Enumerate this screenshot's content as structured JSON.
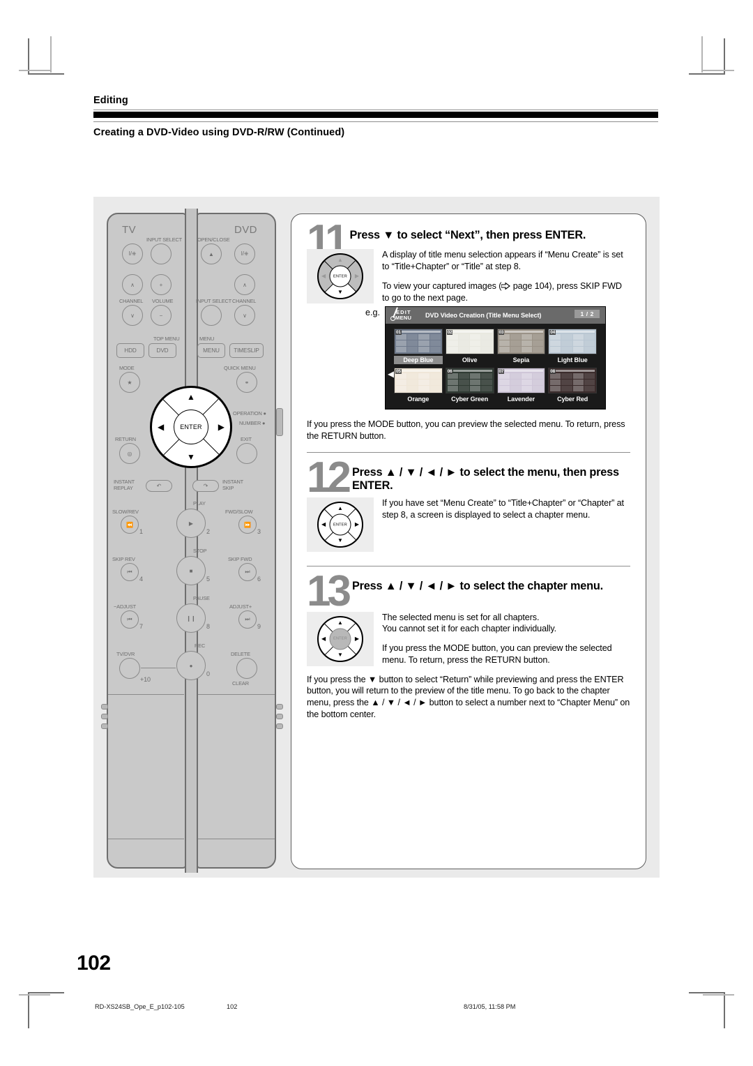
{
  "header": {
    "eyebrow": "Editing",
    "title": "Creating a DVD-Video using DVD-R/RW (Continued)"
  },
  "steps": [
    {
      "number": "11",
      "title": "Press ▼ to select “Next”, then press ENTER.",
      "dpad_label": "ENTER",
      "paragraphs": [
        "A display of title menu selection appears if “Menu Create” is set to “Title+Chapter” or “Title” at step 8.",
        "To view your captured images ( page 104), press SKIP FWD to go to the next page."
      ],
      "example_label": "e.g.",
      "after_note": "If you press the MODE button, you can preview the selected menu. To return, press the RETURN button."
    },
    {
      "number": "12",
      "title": "Press ▲ / ▼ / ◄ / ► to select the menu, then press ENTER.",
      "dpad_label": "ENTER",
      "paragraphs": [
        "If you have set “Menu Create” to “Title+Chapter” or “Chapter” at step 8, a screen is displayed to select a chapter menu."
      ]
    },
    {
      "number": "13",
      "title": "Press ▲ / ▼ / ◄ / ► to select the chapter menu.",
      "dpad_label": "ENTER",
      "paragraphs": [
        "The selected menu is set for all chapters.\nYou cannot set it for each chapter individually.",
        "If you press the MODE button, you can preview the selected menu. To return, press the RETURN button.",
        "If you press the ▼ button to select “Return” while previewing and press the ENTER button, you will return to the preview of the title menu. To go back to the chapter menu, press the ▲ / ▼ / ◄ / ► button to select a number next to “Chapter Menu” on the bottom center."
      ]
    }
  ],
  "screenshot": {
    "logo_line1": "EDIT",
    "logo_line2": "MENU",
    "title": "DVD Video Creation (Title Menu Select)",
    "page_indicator": "1 / 2",
    "prev_arrow": "◀",
    "next_arrow": "▶",
    "thumbnails": [
      {
        "badge": "01",
        "name": "Deep Blue",
        "selected": true,
        "bg": "#6f7a8c"
      },
      {
        "badge": "02",
        "name": "Olive",
        "selected": false,
        "bg": "#e8e8e0"
      },
      {
        "badge": "03",
        "name": "Sepia",
        "selected": false,
        "bg": "#9a9287"
      },
      {
        "badge": "04",
        "name": "Light Blue",
        "selected": false,
        "bg": "#b9c6d2"
      },
      {
        "badge": "05",
        "name": "Orange",
        "selected": false,
        "bg": "#efe6d8"
      },
      {
        "badge": "06",
        "name": "Cyber Green",
        "selected": false,
        "bg": "#2f3a33"
      },
      {
        "badge": "07",
        "name": "Lavender",
        "selected": false,
        "bg": "#cfc6d8"
      },
      {
        "badge": "08",
        "name": "Cyber Red",
        "selected": false,
        "bg": "#3a2b2b"
      }
    ]
  },
  "remote": {
    "brand_tv": "TV",
    "brand_dvd": "DVD",
    "labels": {
      "input_select_l": "INPUT SELECT",
      "open_close": "OPEN/CLOSE",
      "channel_l": "CHANNEL",
      "volume": "VOLUME",
      "input_select_r": "INPUT SELECT",
      "channel_r": "CHANNEL",
      "top_menu": "TOP MENU",
      "menu": "MENU",
      "hdd": "HDD",
      "dvd_btn": "DVD",
      "menu_btn": "MENU",
      "timeslip": "TIMESLIP",
      "mode": "MODE",
      "quick_menu": "QUICK MENU",
      "operation": "OPERATION",
      "number": "NUMBER",
      "return": "RETURN",
      "exit": "EXIT",
      "enter": "ENTER",
      "instant_replay": "INSTANT\nREPLAY",
      "instant_skip": "INSTANT\nSKIP",
      "slow_rev": "SLOW/REV",
      "play": "PLAY",
      "fwd_slow": "FWD/SLOW",
      "skip_rev": "SKIP REV",
      "stop": "STOP",
      "skip_fwd": "SKIP FWD",
      "adjust_minus": "−ADJUST",
      "pause": "PAUSE",
      "adjust_plus": "ADJUST+",
      "tv_dvr": "TV/DVR",
      "rec": "REC",
      "delete": "DELETE",
      "clear": "CLEAR",
      "plus10": "+10"
    },
    "numbers": {
      "n1": "1",
      "n2": "2",
      "n3": "3",
      "n4": "4",
      "n5": "5",
      "n6": "6",
      "n7": "7",
      "n8": "8",
      "n9": "9",
      "n0": "0"
    }
  },
  "page_number": "102",
  "footer": {
    "file": "RD-XS24SB_Ope_E_p102-105",
    "page": "102",
    "timestamp": "8/31/05, 11:58 PM"
  }
}
